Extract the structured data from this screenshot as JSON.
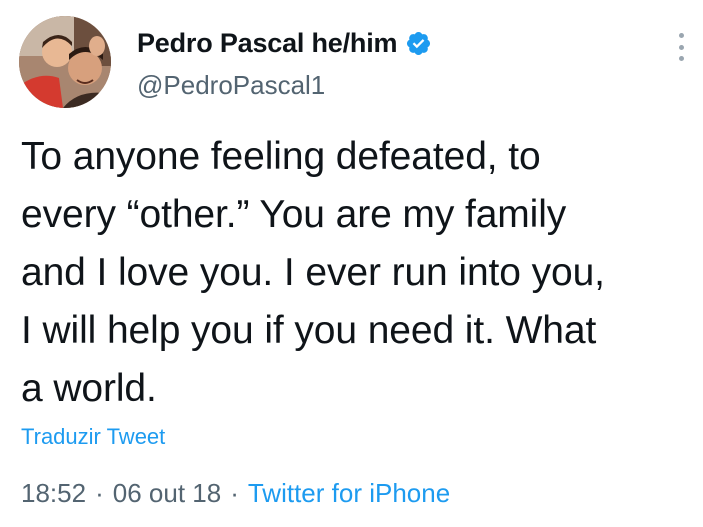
{
  "author": {
    "display_name": "Pedro Pascal he/him",
    "handle": "@PedroPascal1",
    "verified_icon": "verified-badge-icon",
    "avatar": "profile-photo"
  },
  "tweet": {
    "text_lines": [
      "To anyone feeling defeated, to",
      "every “other.” You are my family",
      "and I love you. I ever run into you,",
      "I will help you if you need it. What",
      "a world."
    ],
    "translate_label": "Traduzir Tweet",
    "time": "18:52",
    "date": "06 out 18",
    "source": "Twitter for iPhone",
    "separator": "·"
  },
  "menu": {
    "icon": "more-options-icon"
  },
  "colors": {
    "link": "#1d9bf0",
    "secondary_text": "#536471",
    "primary_text": "#0f1419",
    "verified": "#1d9bf0"
  }
}
